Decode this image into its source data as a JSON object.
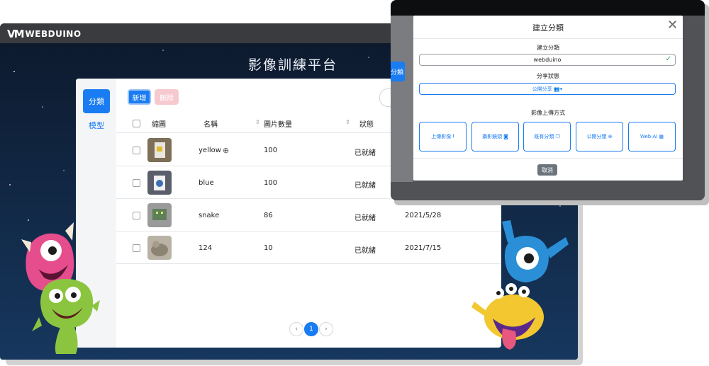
{
  "app": {
    "brand": "WEBDUINO",
    "page_title": "影像訓練平台"
  },
  "sidebar": {
    "items": [
      {
        "label": "分類",
        "active": true
      },
      {
        "label": "模型",
        "active": false
      }
    ]
  },
  "toolbar": {
    "add_label": "新增",
    "delete_label": "刪除"
  },
  "table": {
    "columns": [
      "縮圖",
      "名稱",
      "圖片數量",
      "狀態"
    ],
    "rows": [
      {
        "name": "yellow",
        "count": "100",
        "status": "已就緒",
        "date": "",
        "public": true
      },
      {
        "name": "blue",
        "count": "100",
        "status": "已就緒",
        "date": "",
        "public": false
      },
      {
        "name": "snake",
        "count": "86",
        "status": "已就緒",
        "date": "2021/5/28",
        "public": false
      },
      {
        "name": "124",
        "count": "10",
        "status": "已就緒",
        "date": "2021/7/15",
        "public": false
      }
    ]
  },
  "pagination": {
    "prev": "‹",
    "current": "1",
    "next": "›"
  },
  "background_tab": {
    "label": "分類"
  },
  "modal": {
    "title": "建立分類",
    "name_label": "建立分類",
    "name_value": "webduino",
    "share_label": "分享狀態",
    "share_value": "公開分享",
    "upload_label": "影像上傳方式",
    "upload_buttons": [
      {
        "label": "上傳影像",
        "icon": "upload-icon"
      },
      {
        "label": "攝影鏡頭",
        "icon": "camera-icon"
      },
      {
        "label": "既有分類",
        "icon": "copy-icon"
      },
      {
        "label": "公開分類",
        "icon": "globe-icon"
      },
      {
        "label": "Web:AI",
        "icon": "grid-icon"
      }
    ],
    "cancel_label": "取消"
  },
  "colors": {
    "primary": "#1a7cf2",
    "danger_light": "#f6c9cf",
    "success": "#26a65b",
    "dark_bg": "#0f1e34",
    "titlebar": "#3a3b3e"
  }
}
